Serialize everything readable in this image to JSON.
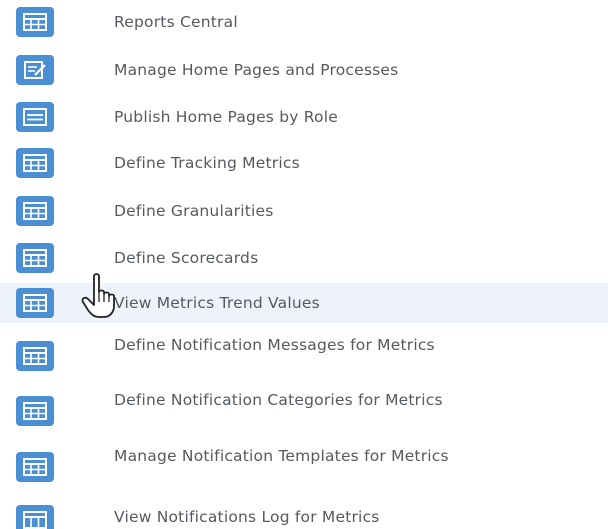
{
  "menu": {
    "items": [
      {
        "label": "Reports Central",
        "icon": "grid-icon"
      },
      {
        "label": "Manage Home Pages and Processes",
        "icon": "edit-doc-icon"
      },
      {
        "label": "Publish Home Pages by Role",
        "icon": "list-icon"
      },
      {
        "label": "Define Tracking Metrics",
        "icon": "grid-icon"
      },
      {
        "label": "Define Granularities",
        "icon": "grid-icon"
      },
      {
        "label": "Define Scorecards",
        "icon": "grid-icon"
      },
      {
        "label": "View Metrics Trend Values",
        "icon": "grid-icon",
        "hovered": true
      },
      {
        "label": "Define Notification Messages for Metrics",
        "icon": "grid-icon"
      },
      {
        "label": "Define Notification Categories for Metrics",
        "icon": "grid-icon"
      },
      {
        "label": "Manage Notification Templates for Metrics",
        "icon": "grid-icon"
      },
      {
        "label": "View Notifications Log for Metrics",
        "icon": "grid-icon"
      }
    ]
  },
  "colors": {
    "icon_bg": "#4a8ed3",
    "hover_bg": "#edf3f9",
    "text": "#555a60"
  },
  "cursor": {
    "icon": "hand-pointer-icon"
  }
}
